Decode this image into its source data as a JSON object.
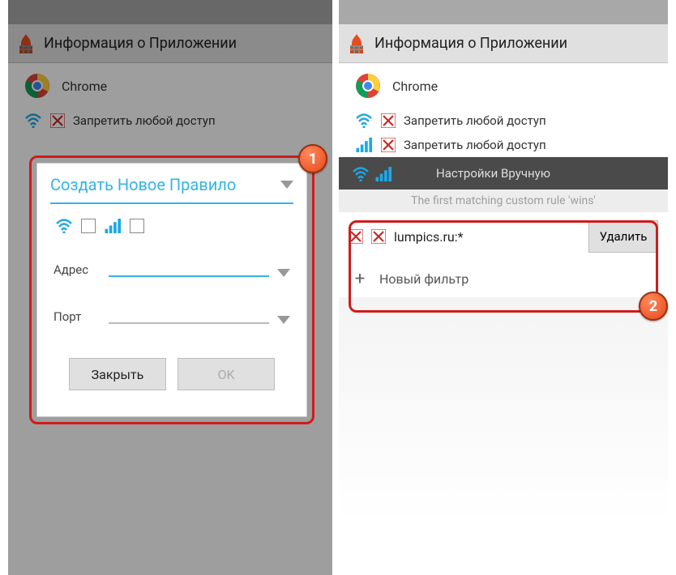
{
  "header": {
    "title": "Информация о Приложении"
  },
  "app": {
    "name": "Chrome"
  },
  "rules": {
    "denyAny": "Запретить любой доступ",
    "manualHeader": "Настройки Вручную",
    "hint": "The first matching custom rule 'wins'"
  },
  "modal": {
    "title": "Создать Новое Правило",
    "addressLabel": "Адрес",
    "portLabel": "Порт",
    "closeBtn": "Закрыть",
    "okBtn": "OK"
  },
  "filter": {
    "ruleText": "lumpics.ru:*",
    "deleteBtn": "Удалить",
    "newFilter": "Новый фильтр"
  },
  "badges": {
    "one": "1",
    "two": "2"
  }
}
